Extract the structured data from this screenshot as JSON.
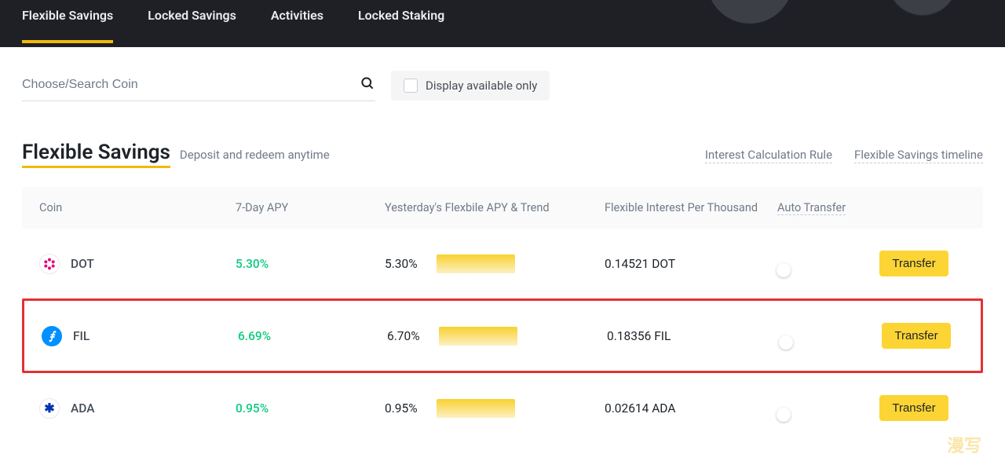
{
  "tabs": {
    "flexible": "Flexible Savings",
    "locked": "Locked Savings",
    "activities": "Activities",
    "staking": "Locked Staking"
  },
  "search": {
    "placeholder": "Choose/Search Coin"
  },
  "availableOnly": {
    "label": "Display available only"
  },
  "title": "Flexible Savings",
  "subtitle": "Deposit and redeem anytime",
  "links": {
    "interest": "Interest Calculation Rule",
    "timeline": "Flexible Savings timeline"
  },
  "headers": {
    "coin": "Coin",
    "apy7": "7-Day APY",
    "yesterday": "Yesterday's Flexbile APY & Trend",
    "interest": "Flexible Interest Per Thousand",
    "auto": "Auto Transfer"
  },
  "rows": [
    {
      "symbol": "DOT",
      "apy7": "5.30%",
      "yesterday": "5.30%",
      "interestPerK": "0.14521 DOT",
      "transfer": "Transfer"
    },
    {
      "symbol": "FIL",
      "apy7": "6.69%",
      "yesterday": "6.70%",
      "interestPerK": "0.18356 FIL",
      "transfer": "Transfer"
    },
    {
      "symbol": "ADA",
      "apy7": "0.95%",
      "yesterday": "0.95%",
      "interestPerK": "0.02614 ADA",
      "transfer": "Transfer"
    }
  ],
  "watermark": "漫写"
}
